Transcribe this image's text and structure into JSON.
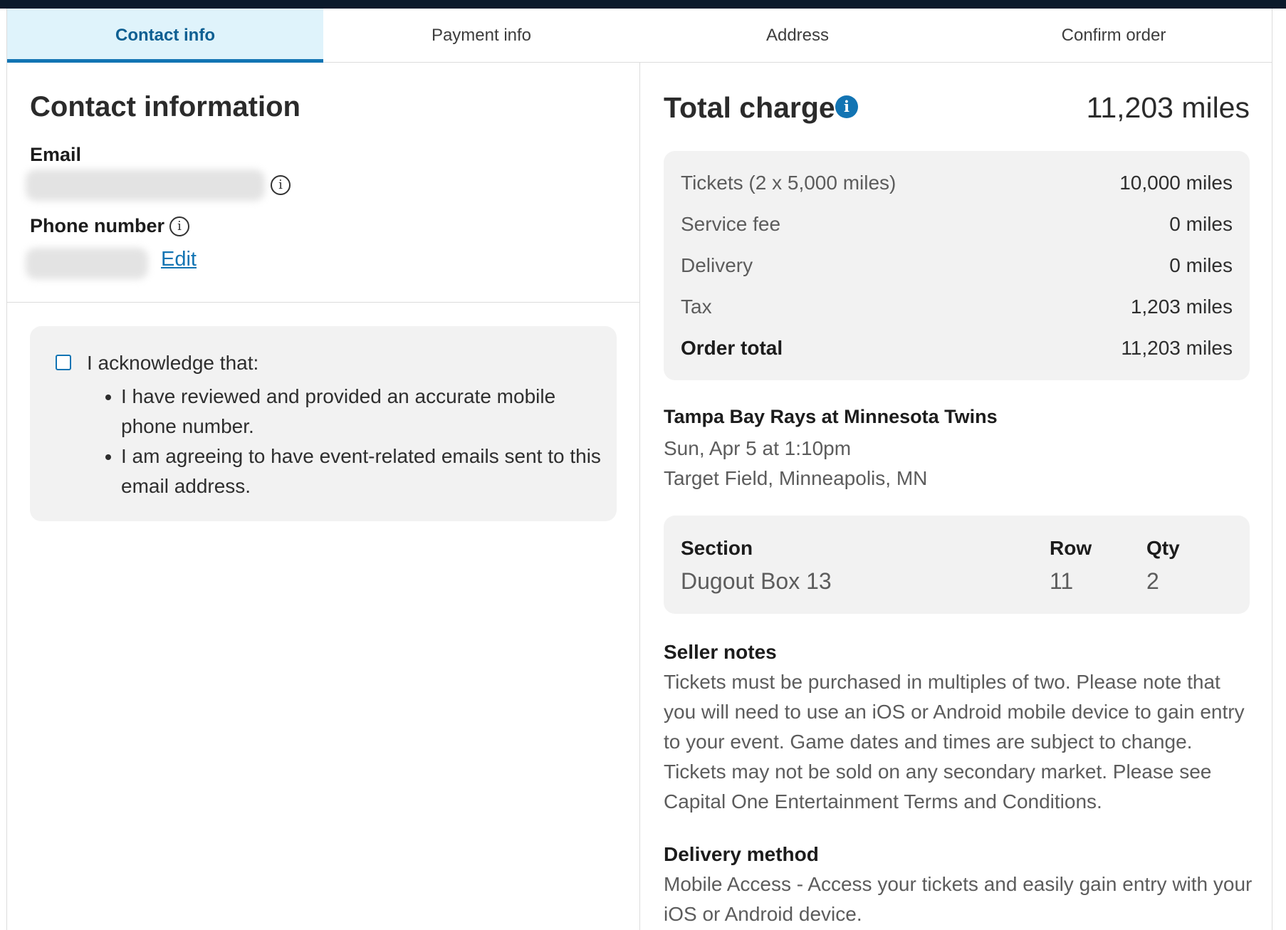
{
  "tabs": [
    {
      "label": "Contact info",
      "active": true
    },
    {
      "label": "Payment info",
      "active": false
    },
    {
      "label": "Address",
      "active": false
    },
    {
      "label": "Confirm order",
      "active": false
    }
  ],
  "contact": {
    "title": "Contact information",
    "email_label": "Email",
    "phone_label": "Phone number",
    "edit_label": "Edit"
  },
  "acknowledgement": {
    "checked": false,
    "intro": "I acknowledge that:",
    "items": [
      "I have reviewed and provided an accurate mobile phone number.",
      "I am agreeing to have event-related emails sent to this email address."
    ]
  },
  "total": {
    "title": "Total charge",
    "amount": "11,203 miles",
    "rows": [
      {
        "label": "Tickets (2 x 5,000 miles)",
        "value": "10,000 miles"
      },
      {
        "label": "Service fee",
        "value": "0 miles"
      },
      {
        "label": "Delivery",
        "value": "0 miles"
      },
      {
        "label": "Tax",
        "value": "1,203 miles"
      },
      {
        "label": "Order total",
        "value": "11,203 miles"
      }
    ]
  },
  "event": {
    "title": "Tampa Bay Rays at Minnesota Twins",
    "datetime": "Sun, Apr 5 at 1:10pm",
    "venue": "Target Field, Minneapolis, MN"
  },
  "seats": {
    "section_label": "Section",
    "row_label": "Row",
    "qty_label": "Qty",
    "section": "Dugout Box 13",
    "row": "11",
    "qty": "2"
  },
  "seller_notes": {
    "title": "Seller notes",
    "text": "Tickets must be purchased in multiples of two. Please note that you will need to use an iOS or Android mobile device to gain entry to your event. Game dates and times are subject to change. Tickets may not be sold on any secondary market. Please see Capital One Entertainment Terms and Conditions."
  },
  "delivery_method": {
    "title": "Delivery method",
    "text": "Mobile Access - Access your tickets and easily gain entry with your iOS or Android device."
  },
  "colors": {
    "accent": "#1274b3",
    "active_tab_bg": "#dff3fb",
    "panel_bg": "#f2f2f2",
    "topbar": "#0b1a2b"
  }
}
